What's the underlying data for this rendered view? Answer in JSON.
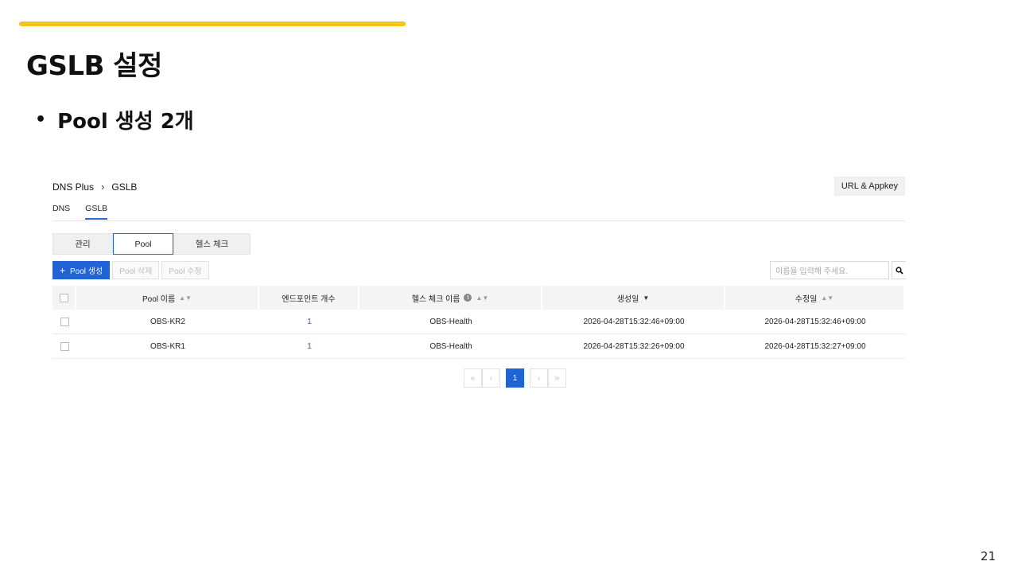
{
  "slide": {
    "title": "GSLB 설정",
    "bullet": "Pool 생성 2개",
    "bullet_glyph": "•",
    "page_number": "21",
    "accent_color": "#f5c518"
  },
  "breadcrumb": {
    "root": "DNS Plus",
    "separator": "›",
    "current": "GSLB"
  },
  "appkey_button": "URL & Appkey",
  "subnav": [
    "DNS",
    "GSLB"
  ],
  "tabs": [
    "관리",
    "Pool",
    "헬스 체크"
  ],
  "toolbar": {
    "create_plus": "+",
    "create_label": "Pool 생성",
    "delete_label": "Pool 삭제",
    "edit_label": "Pool 수정"
  },
  "search": {
    "placeholder": "이름을 입력해 주세요."
  },
  "table": {
    "headers": [
      "Pool 이름",
      "엔드포인트 개수",
      "헬스 체크 이름",
      "생성일",
      "수정일"
    ],
    "rows": [
      {
        "name": "OBS-KR2",
        "endpoints": "1",
        "health_check": "OBS-Health",
        "created": "2026-04-28T15:32:46+09:00",
        "modified": "2026-04-28T15:32:46+09:00"
      },
      {
        "name": "OBS-KR1",
        "endpoints": "1",
        "health_check": "OBS-Health",
        "created": "2026-04-28T15:32:26+09:00",
        "modified": "2026-04-28T15:32:27+09:00"
      }
    ]
  },
  "pagination": {
    "first": "«",
    "prev": "‹",
    "current": "1",
    "next": "›",
    "last": "»"
  },
  "colors": {
    "primary": "#1f63d6",
    "accent": "#f5c518"
  }
}
